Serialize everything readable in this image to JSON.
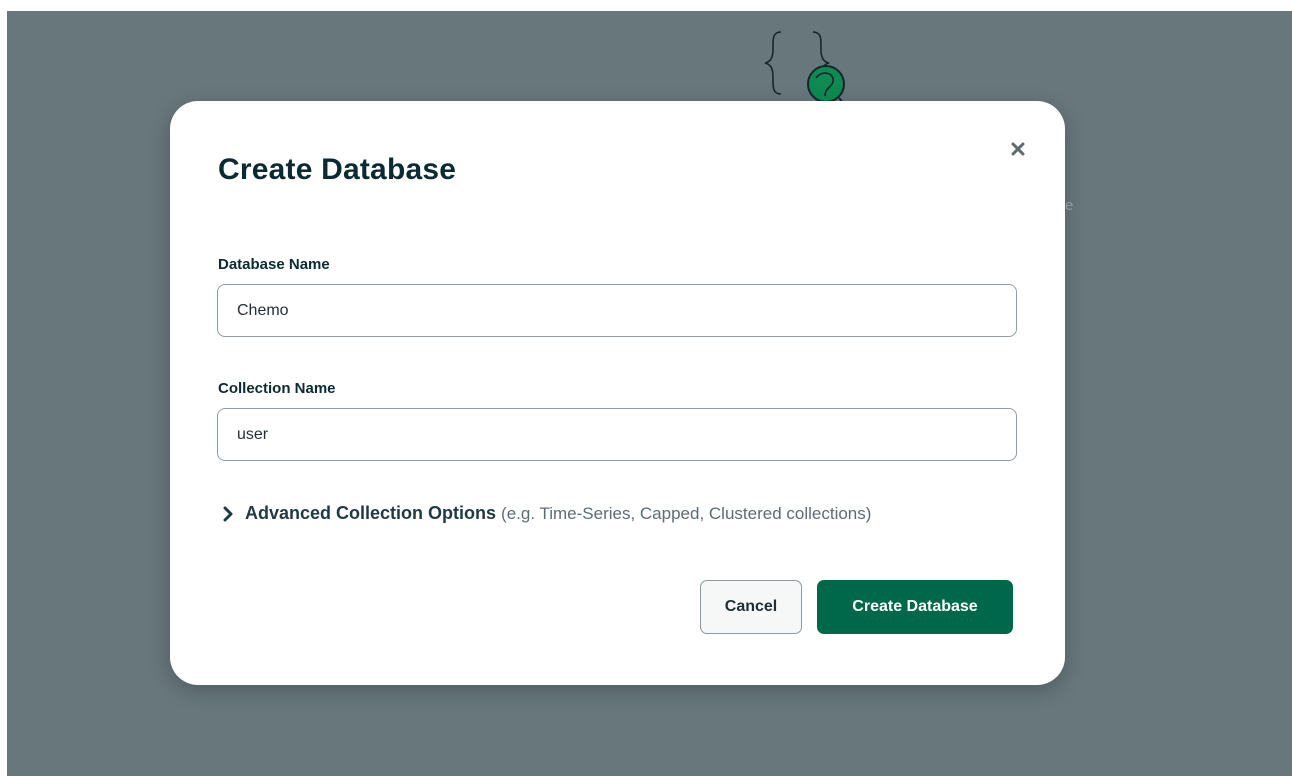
{
  "modal": {
    "title": "Create Database",
    "close_icon": "close-icon",
    "fields": {
      "database_name": {
        "label": "Database Name",
        "value": "Chemo"
      },
      "collection_name": {
        "label": "Collection Name",
        "value": "user"
      }
    },
    "advanced_options": {
      "icon": "chevron-right-icon",
      "label": "Advanced Collection Options",
      "hint": "(e.g. Time-Series, Capped, Clustered collections)"
    },
    "buttons": {
      "cancel_label": "Cancel",
      "create_label": "Create Database"
    }
  },
  "background": {
    "illustration_icon": "database-illustration-icon",
    "stray_text": "e"
  },
  "colors": {
    "backdrop": "#67777c",
    "primary_button": "#00684a",
    "title_text": "#0b2a32",
    "illustration_accent": "#0e8a52"
  }
}
